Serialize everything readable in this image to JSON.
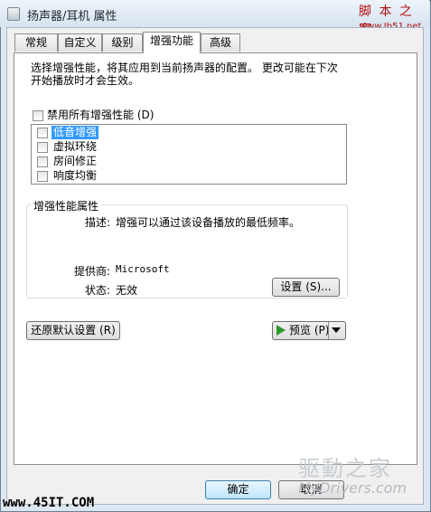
{
  "window": {
    "title": "扬声器/耳机 属性"
  },
  "watermarks": {
    "top_right": "脚 本 之 家",
    "top_right_url": "www.Jb51.net",
    "bottom_left": "www.45IT.COM",
    "brand": "驱動之家",
    "brand_url": "MyDrivers.com"
  },
  "tabs": [
    {
      "label": "常规"
    },
    {
      "label": "自定义"
    },
    {
      "label": "级别"
    },
    {
      "label": "增强功能"
    },
    {
      "label": "高级"
    }
  ],
  "description": {
    "line1": "选择增强性能，将其应用到当前扬声器的配置。  更改可能在下次",
    "line2": "开始播放时才会生效。"
  },
  "disable_all": {
    "label": "禁用所有增强性能 (D)",
    "checked": false
  },
  "enhancements": [
    {
      "label": "低音增强",
      "checked": false,
      "selected": true
    },
    {
      "label": "虚拟环绕",
      "checked": false,
      "selected": false
    },
    {
      "label": "房间修正",
      "checked": false,
      "selected": false
    },
    {
      "label": "响度均衡",
      "checked": false,
      "selected": false
    }
  ],
  "properties": {
    "group_title": "增强性能属性",
    "description_label": "描述:",
    "description_value": "增强可以通过该设备播放的最低频率。",
    "provider_label": "提供商:",
    "provider_value": "Microsoft",
    "status_label": "状态:",
    "status_value": "无效",
    "settings_button": "设置 (S)..."
  },
  "buttons": {
    "restore_defaults": "还原默认设置 (R)",
    "preview": "预览 (P)",
    "ok": "确定",
    "cancel": "取消"
  }
}
